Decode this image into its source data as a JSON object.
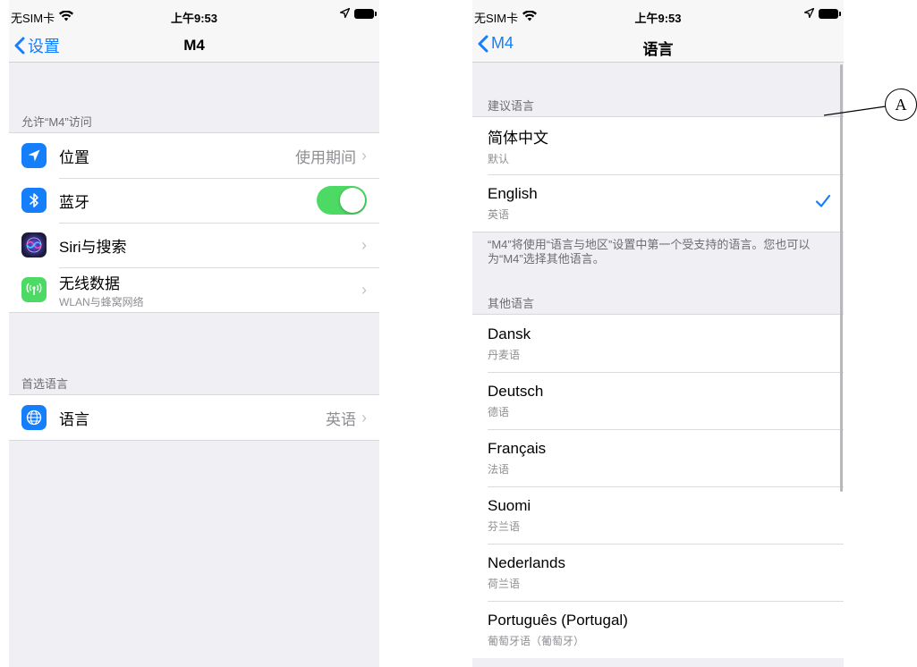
{
  "left_phone": {
    "status": {
      "carrier": "无SIM卡",
      "time": "上午9:53"
    },
    "nav": {
      "back": "设置",
      "title": "M4"
    },
    "section_access": "允许“M4”访问",
    "items": [
      {
        "label": "位置",
        "value": "使用期间",
        "icon": "location-arrow-icon",
        "icon_color": "#147efb"
      },
      {
        "label": "蓝牙",
        "toggle": "on",
        "icon": "bluetooth-icon",
        "icon_color": "#147efb"
      },
      {
        "label": "Siri与搜索",
        "icon": "siri-icon",
        "icon_color": "#1c1c3a"
      },
      {
        "label": "无线数据",
        "sub": "WLAN与蜂窝网络",
        "icon": "antenna-icon",
        "icon_color": "#4cd964"
      }
    ],
    "section_lang": "首选语言",
    "lang_item": {
      "label": "语言",
      "value": "英语",
      "icon": "globe-icon",
      "icon_color": "#147efb"
    }
  },
  "right_phone": {
    "status": {
      "carrier": "无SIM卡",
      "time": "上午9:53"
    },
    "nav": {
      "back": "M4",
      "title": "语言"
    },
    "section_suggested": "建议语言",
    "suggested": [
      {
        "name": "简体中文",
        "native": "默认"
      },
      {
        "name": "English",
        "native": "英语",
        "checked": true
      }
    ],
    "note": "“M4”将使用“语言与地区”设置中第一个受支持的语言。您也可以为“M4”选择其他语言。",
    "section_other": "其他语言",
    "other": [
      {
        "name": "Dansk",
        "native": "丹麦语"
      },
      {
        "name": "Deutsch",
        "native": "德语"
      },
      {
        "name": "Français",
        "native": "法语"
      },
      {
        "name": "Suomi",
        "native": "芬兰语"
      },
      {
        "name": "Nederlands",
        "native": "荷兰语"
      },
      {
        "name": "Português (Portugal)",
        "native": "葡萄牙语（葡萄牙）"
      }
    ]
  },
  "annotation": {
    "label": "A"
  },
  "colors": {
    "accent": "#147efb",
    "toggle_on": "#4cd964"
  }
}
